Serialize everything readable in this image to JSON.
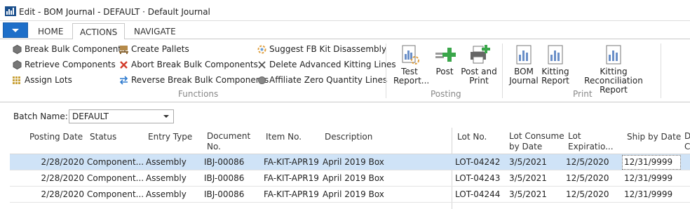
{
  "window": {
    "title": "Edit - BOM Journal - DEFAULT · Default Journal"
  },
  "ribbon": {
    "tabs": [
      {
        "label": "HOME",
        "active": false
      },
      {
        "label": "ACTIONS",
        "active": true
      },
      {
        "label": "NAVIGATE",
        "active": false
      }
    ],
    "functions": {
      "label": "Functions",
      "col1": [
        "Break Bulk Components",
        "Retrieve Components",
        "Assign Lots"
      ],
      "col2": [
        "Create Pallets",
        "Abort Break Bulk Components",
        "Reverse Break Bulk Components"
      ],
      "col3": [
        "Suggest FB Kit Disassembly",
        "Delete Advanced Kitting Lines",
        "Affiliate Zero Quantity Lines"
      ]
    },
    "posting": {
      "label": "Posting",
      "buttons": [
        {
          "line1": "Test",
          "line2": "Report..."
        },
        {
          "line1": "Post",
          "line2": ""
        },
        {
          "line1": "Post and",
          "line2": "Print"
        }
      ]
    },
    "print": {
      "label": "Print",
      "buttons": [
        {
          "line1": "BOM",
          "line2": "Journal"
        },
        {
          "line1": "Kitting",
          "line2": "Report"
        },
        {
          "line1": "Kitting",
          "line2": "Reconciliation Report"
        }
      ]
    }
  },
  "filter": {
    "batch_label": "Batch Name:",
    "batch_value": "DEFAULT"
  },
  "grid": {
    "headers": {
      "posting_date": "Posting Date",
      "status": "Status",
      "entry_type": "Entry Type",
      "doc_no_1": "Document",
      "doc_no_2": "No.",
      "item_no": "Item No.",
      "description": "Description",
      "lot_no": "Lot No.",
      "lot_consume_1": "Lot Consume",
      "lot_consume_2": "by Date",
      "lot_exp_1": "Lot",
      "lot_exp_2": "Expiratio...",
      "ship_by": "Ship by Date",
      "cut_1": "D",
      "cut_2": "C"
    },
    "rows": [
      {
        "posting_date": "2/28/2020",
        "status": "Component...",
        "entry_type": "Assembly",
        "doc_no": "IBJ-00086",
        "item_no": "FA-KIT-APR19",
        "description": "April 2019 Box",
        "lot_no": "LOT-04242",
        "lot_consume": "3/5/2021",
        "lot_exp": "12/5/2020",
        "ship_by": "12/31/9999"
      },
      {
        "posting_date": "2/28/2020",
        "status": "Component...",
        "entry_type": "Assembly",
        "doc_no": "IBJ-00086",
        "item_no": "FA-KIT-APR19",
        "description": "April 2019 Box",
        "lot_no": "LOT-04243",
        "lot_consume": "3/5/2021",
        "lot_exp": "12/5/2020",
        "ship_by": "12/31/9999"
      },
      {
        "posting_date": "2/28/2020",
        "status": "Component...",
        "entry_type": "Assembly",
        "doc_no": "IBJ-00086",
        "item_no": "FA-KIT-APR19",
        "description": "April 2019 Box",
        "lot_no": "LOT-04244",
        "lot_consume": "3/5/2021",
        "lot_exp": "12/5/2020",
        "ship_by": "12/31/9999"
      }
    ]
  },
  "colors": {
    "accent": "#1e6fc9",
    "selected_row": "#cfe3f7",
    "abort_red": "#d23b2a",
    "post_green": "#3aa64a"
  }
}
